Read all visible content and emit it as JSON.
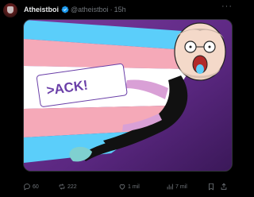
{
  "author": {
    "display_name": "Atheistboi",
    "handle": "@atheistboi",
    "separator": "·",
    "timestamp": "15h",
    "verified": true
  },
  "header": {
    "more_label": "···"
  },
  "media": {
    "type": "image",
    "description_text": ">ACK!",
    "stripe_colors": [
      "#5bcefa",
      "#f5a9b8",
      "#ffffff",
      "#f5a9b8",
      "#5bcefa"
    ],
    "background_color": "#6b2f8e"
  },
  "actions": {
    "reply": {
      "icon": "reply-icon",
      "count": "60"
    },
    "retweet": {
      "icon": "retweet-icon",
      "count": "222"
    },
    "like": {
      "icon": "heart-icon",
      "count": "1 mil"
    },
    "views": {
      "icon": "views-icon",
      "count": "7 mil"
    },
    "bookmark": {
      "icon": "bookmark-icon"
    },
    "share": {
      "icon": "share-icon"
    }
  },
  "colors": {
    "background": "#000000",
    "text_primary": "#e7e9ea",
    "text_secondary": "#71767b",
    "verified": "#1d9bf0"
  }
}
